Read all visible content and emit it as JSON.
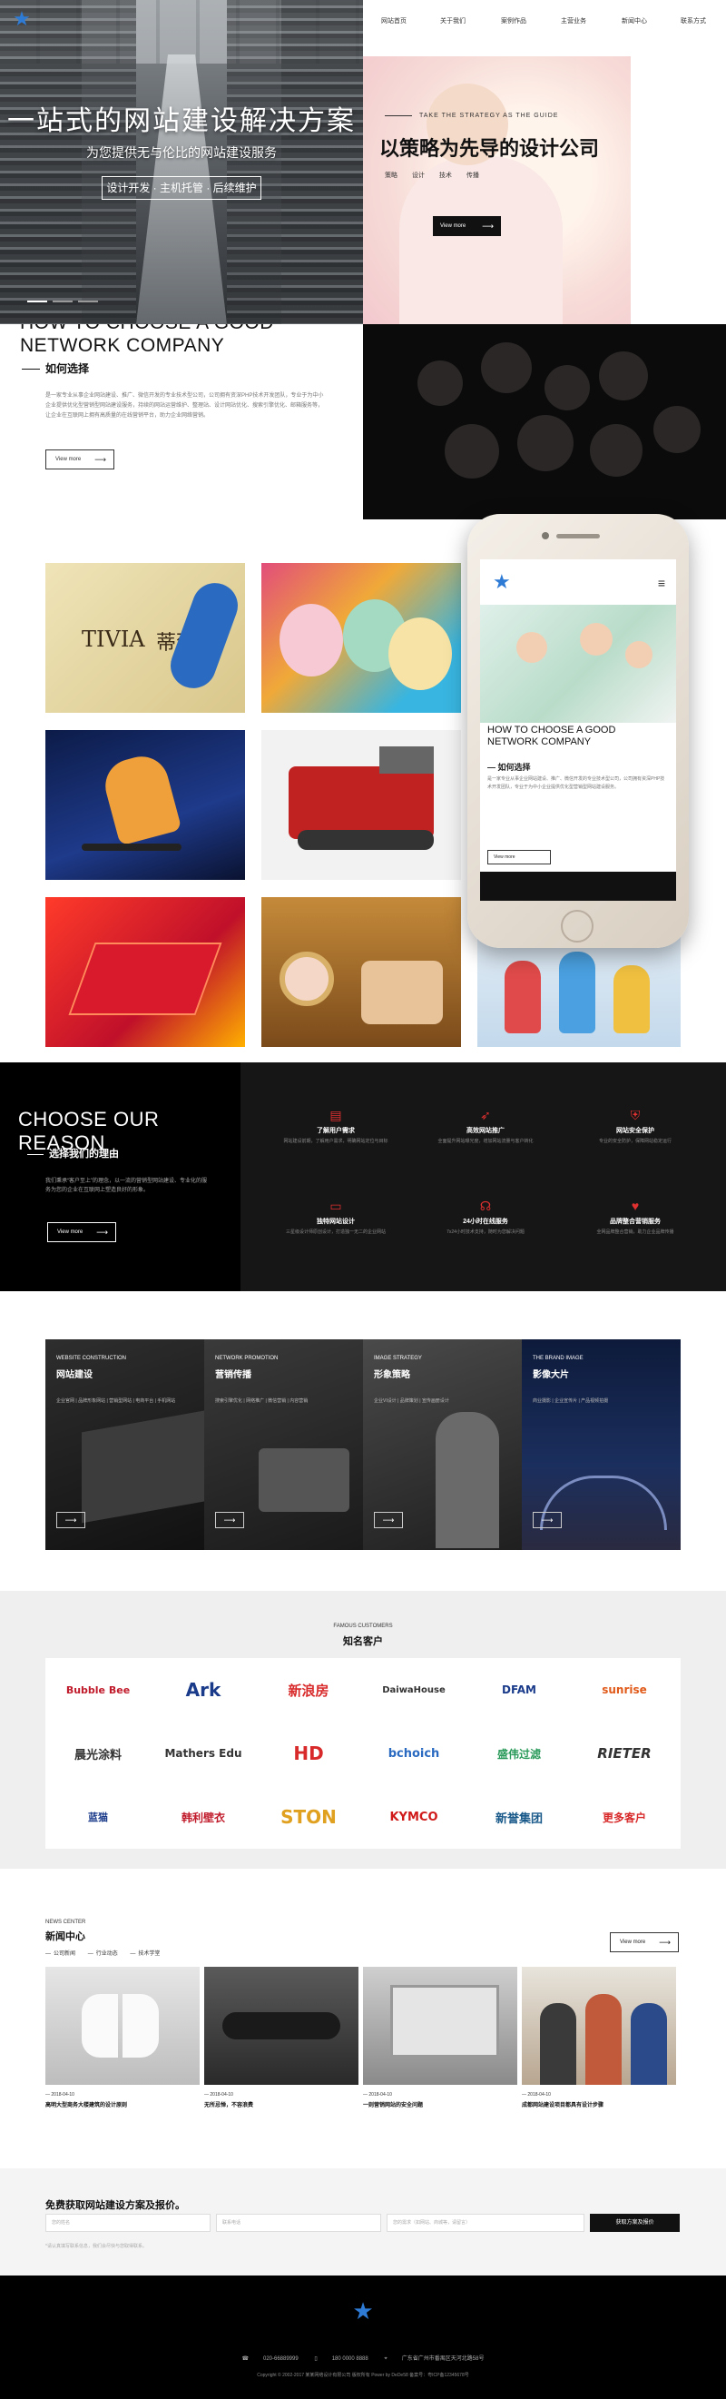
{
  "nav": [
    "网站首页",
    "关于我们",
    "案例作品",
    "主营业务",
    "新闻中心",
    "联系方式"
  ],
  "hero": {
    "title": "一站式的网站建设解决方案",
    "subtitle": "为您提供无与伦比的网站建设服务",
    "tags": "设计开发 · 主机托管 · 后续维护"
  },
  "hero_right": {
    "tagline": "TAKE THE STRATEGY AS THE GUIDE",
    "title": "以策略为先导的设计公司",
    "links": [
      "策略",
      "设计",
      "技术",
      "传播"
    ],
    "button": "View more"
  },
  "how": {
    "title_line1": "HOW TO CHOOSE A GOOD",
    "title_line2": "NETWORK COMPANY",
    "subtitle": "如何选择",
    "text": "是一家专业从事企业网站建设、推广、微信开发的专业技术型公司，公司拥有资深PHP技术开发团队，专业于为中小企业提供优化型营销型网站建设服务，持续的网站运营维护、整理站、设计网站优化、搜索引擎优化、邮箱服务等，让企业在互联网上拥有高质量的在线营销平台，助力企业网络营销。",
    "button": "View more"
  },
  "gallery_logo_text": "蒂薇娜",
  "gallery_logo_brand": "TIVIA",
  "phone": {
    "title": "HOW TO CHOOSE A GOOD NETWORK COMPANY",
    "subtitle": "— 如何选择",
    "text": "是一家专业从事企业网站建设、推广、微信开发的专业技术型公司，公司拥有资深PHP技术开发团队，专业于为中小企业提供优化型营销型网站建设服务。",
    "button": "View more"
  },
  "reason": {
    "title": "CHOOSE OUR REASON",
    "subtitle": "选择我们的理由",
    "text": "我们秉承“客户至上”的理念，以一流的营销型网站建设、专业化的服务为您的企业在互联网上塑造良好的形象。",
    "button": "View more",
    "features": [
      {
        "title": "了解用户需求",
        "desc": "网站建设前期，了解用户需求，明确网站定位与目标"
      },
      {
        "title": "高效网站推广",
        "desc": "全面提升网站曝光度，增加网站流量与客户转化"
      },
      {
        "title": "网站安全保护",
        "desc": "专业的安全防护，保障网站稳定运行"
      },
      {
        "title": "独特网站设计",
        "desc": "三星级设计师原创设计，打造独一无二的企业网站"
      },
      {
        "title": "24小时在线服务",
        "desc": "7x24小时技术支持，随时为您解决问题"
      },
      {
        "title": "品牌整合营销服务",
        "desc": "全网品牌整合营销，助力企业品牌传播"
      }
    ]
  },
  "services": [
    {
      "en": "WEBSITE CONSTRUCTION",
      "cn": "网站建设",
      "desc": "企业官网 | 品牌形象网站 | 营销型网站 | 电商平台 | 手机网站"
    },
    {
      "en": "NETWORK PROMOTION",
      "cn": "营销传播",
      "desc": "搜索引擎优化 | 网络推广 | 微信营销 | 内容营销"
    },
    {
      "en": "IMAGE STRATEGY",
      "cn": "形象策略",
      "desc": "企业VI设计 | 品牌策划 | 宣传画册设计"
    },
    {
      "en": "THE BRAND IMAGE",
      "cn": "影像大片",
      "desc": "商业摄影 | 企业宣传片 | 产品视频拍摄"
    }
  ],
  "customers": {
    "en": "FAMOUS CUSTOMERS",
    "cn": "知名客户",
    "logos": [
      "Bubble Bee",
      "Ark",
      "新浪房",
      "DaiwaHouse",
      "DFAM",
      "sunrise",
      "晨光涂料",
      "Mathers Edu",
      "HD",
      "bchoich",
      "盛伟过滤",
      "RIETER",
      "蓝猫",
      "韩利壁衣",
      "STON",
      "KYMCO",
      "新誉集团",
      "更多客户"
    ]
  },
  "news": {
    "en": "NEWS CENTER",
    "cn": "新闻中心",
    "tabs": [
      "公司新闻",
      "行业动态",
      "技术学堂"
    ],
    "more": "View more",
    "items": [
      {
        "date": "— 2018-04-10",
        "title": "高明大型商务大楼建筑的设计原则"
      },
      {
        "date": "— 2018-04-10",
        "title": "无所忌惮，不容浪费"
      },
      {
        "date": "— 2018-04-10",
        "title": "一则营销网站的安全问题"
      },
      {
        "date": "— 2018-04-10",
        "title": "成都网站建设项目都具有设计步骤"
      }
    ]
  },
  "form": {
    "title": "免费获取网站建设方案及报价。",
    "fields": [
      "您的姓名",
      "联系电话",
      "您的需求（如网站、商城等，请留言）"
    ],
    "submit": "获取方案及报价",
    "note": "*请认真填写联系信息，我们会尽快与您取得联系。"
  },
  "footer": {
    "phone": "020-66889999",
    "mobile": "180 0000 8888",
    "address": "广东省广州市番禺区天河北路58号",
    "copyright": "Copyright © 2002-2017 某某网络设计有限公司 版权所有 Power by DeDe58 备案号：粤ICP备12345678号"
  }
}
